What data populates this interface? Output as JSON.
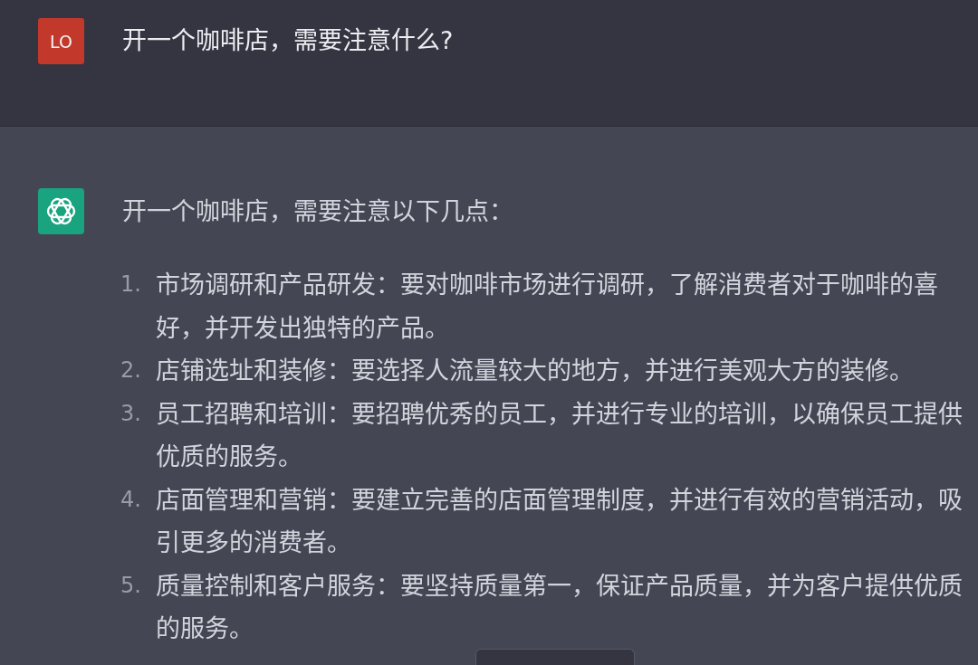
{
  "conversation": [
    {
      "kind": "user",
      "avatar_initials": "LO",
      "text": "开一个咖啡店，需要注意什么?"
    },
    {
      "kind": "assistant",
      "text": "开一个咖啡店，需要注意以下几点：",
      "list": [
        {
          "number": "1.",
          "text": "市场调研和产品研发：要对咖啡市场进行调研，了解消费者对于咖啡的喜好，并开发出独特的产品。"
        },
        {
          "number": "2.",
          "text": "店铺选址和装修：要选择人流量较大的地方，并进行美观大方的装修。"
        },
        {
          "number": "3.",
          "text": "员工招聘和培训：要招聘优秀的员工，并进行专业的培训，以确保员工提供优质的服务。"
        },
        {
          "number": "4.",
          "text": "店面管理和营销：要建立完善的店面管理制度，并进行有效的营销活动，吸引更多的消费者。"
        },
        {
          "number": "5.",
          "text": "质量控制和客户服务：要坚持质量第一，保证产品质量，并为客户提供优质的服务。"
        }
      ]
    }
  ]
}
